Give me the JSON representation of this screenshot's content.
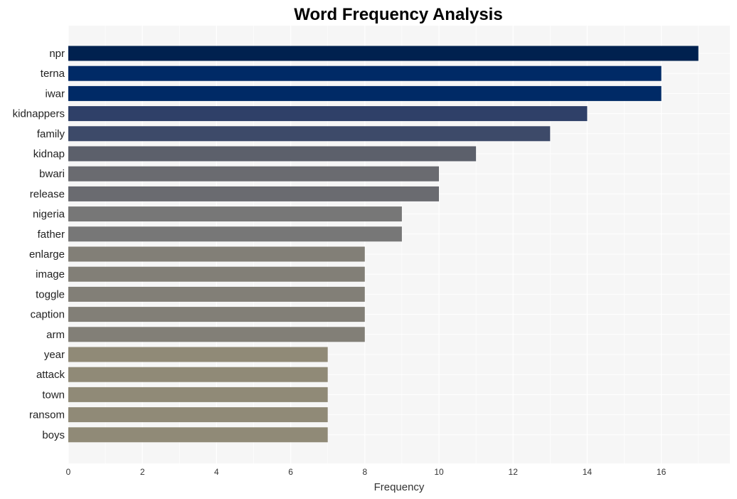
{
  "chart_data": {
    "type": "bar",
    "orientation": "horizontal",
    "title": "Word Frequency Analysis",
    "xlabel": "Frequency",
    "ylabel": "",
    "xlim": [
      0,
      17.85
    ],
    "xticks": [
      0,
      2,
      4,
      6,
      8,
      10,
      12,
      14,
      16
    ],
    "grid": true,
    "legend": "none",
    "categories": [
      "npr",
      "terna",
      "iwar",
      "kidnappers",
      "family",
      "kidnap",
      "bwari",
      "release",
      "nigeria",
      "father",
      "enlarge",
      "image",
      "toggle",
      "caption",
      "arm",
      "year",
      "attack",
      "town",
      "ransom",
      "boys"
    ],
    "values": [
      17,
      16,
      16,
      14,
      13,
      11,
      10,
      10,
      9,
      9,
      8,
      8,
      8,
      8,
      8,
      7,
      7,
      7,
      7,
      7
    ],
    "colors": [
      "#00214f",
      "#002a66",
      "#002a66",
      "#2f4068",
      "#3d4a69",
      "#5c606b",
      "#6a6b70",
      "#6a6b70",
      "#777777",
      "#777777",
      "#827f77",
      "#827f77",
      "#827f77",
      "#827f77",
      "#827f77",
      "#908a77",
      "#908a77",
      "#908a77",
      "#908a77",
      "#908a77"
    ]
  },
  "style": {
    "plot_background": "#f6f6f6",
    "grid_color": "#ffffff"
  }
}
